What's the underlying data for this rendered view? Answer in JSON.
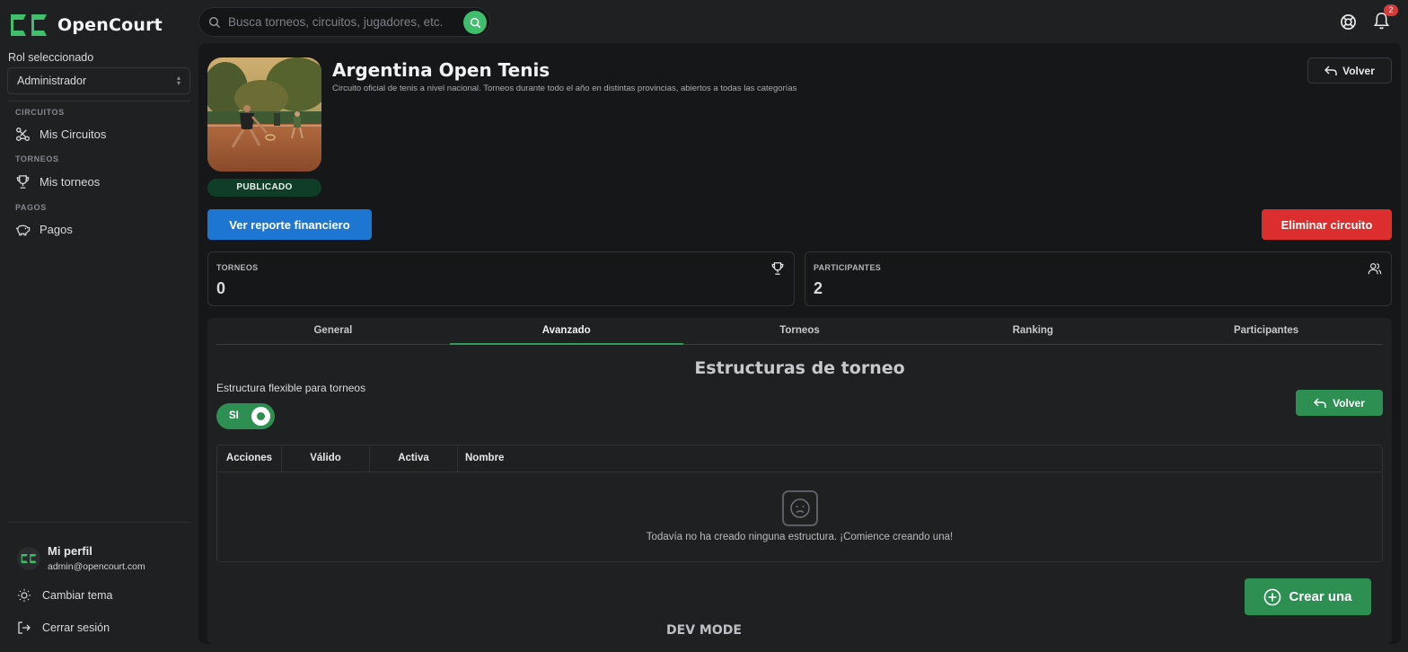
{
  "app": {
    "name": "OpenCourt"
  },
  "search": {
    "placeholder": "Busca torneos, circuitos, jugadores, etc."
  },
  "notifications": {
    "count": "2"
  },
  "sidebar": {
    "role_label": "Rol seleccionado",
    "role_value": "Administrador",
    "sections": [
      {
        "title": "CIRCUITOS",
        "item": "Mis Circuitos",
        "icon": "circuit-icon"
      },
      {
        "title": "TORNEOS",
        "item": "Mis torneos",
        "icon": "trophy-icon"
      },
      {
        "title": "PAGOS",
        "item": "Pagos",
        "icon": "piggy-bank-icon"
      }
    ],
    "profile": {
      "name": "Mi perfil",
      "email": "admin@opencourt.com"
    },
    "theme_label": "Cambiar tema",
    "logout_label": "Cerrar sesión"
  },
  "circuit": {
    "title": "Argentina Open Tenis",
    "description": "Circuito oficial de tenis a nivel nacional. Torneos durante todo el año en distintas provincias, abiertos a todas las categorías",
    "status": "PUBLICADO",
    "back_label": "Volver",
    "report_label": "Ver reporte financiero",
    "delete_label": "Eliminar circuito"
  },
  "stats": [
    {
      "label": "TORNEOS",
      "value": "0"
    },
    {
      "label": "PARTICIPANTES",
      "value": "2"
    }
  ],
  "tabs": [
    "General",
    "Avanzado",
    "Torneos",
    "Ranking",
    "Participantes"
  ],
  "active_tab": "Avanzado",
  "structures": {
    "heading": "Estructuras de torneo",
    "flex_label": "Estructura flexible para torneos",
    "toggle_label": "SI",
    "toggle_on": true,
    "back_label": "Volver",
    "columns": [
      "Acciones",
      "Válido",
      "Activa",
      "Nombre"
    ],
    "empty_text": "Todavía no ha creado ninguna estructura. ¡Comience creando una!",
    "create_label": "Crear una"
  },
  "footer": {
    "dev_mode": "DEV MODE"
  },
  "colors": {
    "accent_green": "#2e8f52",
    "primary_blue": "#1d76d2",
    "danger_red": "#dc2e2e",
    "status_green_bg": "#0f3d27"
  }
}
